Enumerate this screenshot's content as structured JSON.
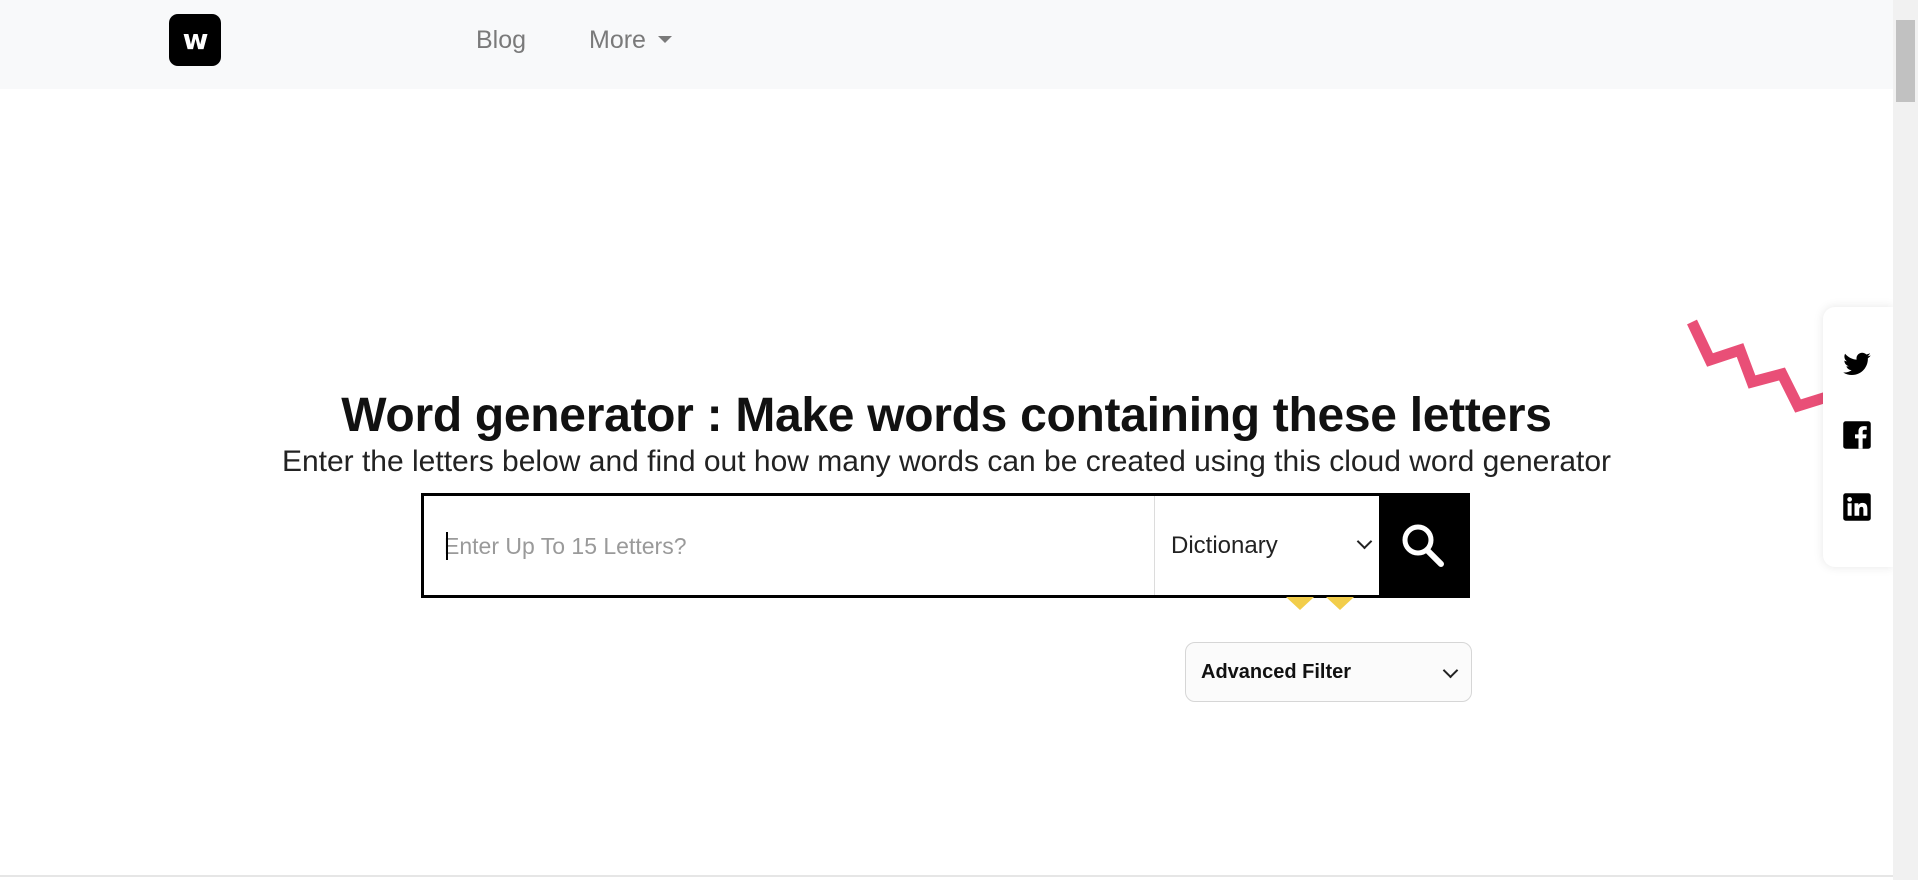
{
  "nav": {
    "logo_text": "w",
    "blog_label": "Blog",
    "more_label": "More"
  },
  "hero": {
    "title": "Word generator : Make words containing these letters",
    "subtitle": "Enter the letters below and find out how many words can be created using this cloud word generator"
  },
  "search": {
    "placeholder": "Enter Up To 15 Letters?",
    "value": "",
    "dictionary_selected": "Dictionary"
  },
  "filter": {
    "advanced_label": "Advanced Filter"
  },
  "social": {
    "icons": [
      "twitter-icon",
      "facebook-icon",
      "linkedin-icon"
    ]
  },
  "colors": {
    "accent_pink": "#e94f77",
    "accent_yellow": "#f2cd4a",
    "primary": "#000000"
  }
}
